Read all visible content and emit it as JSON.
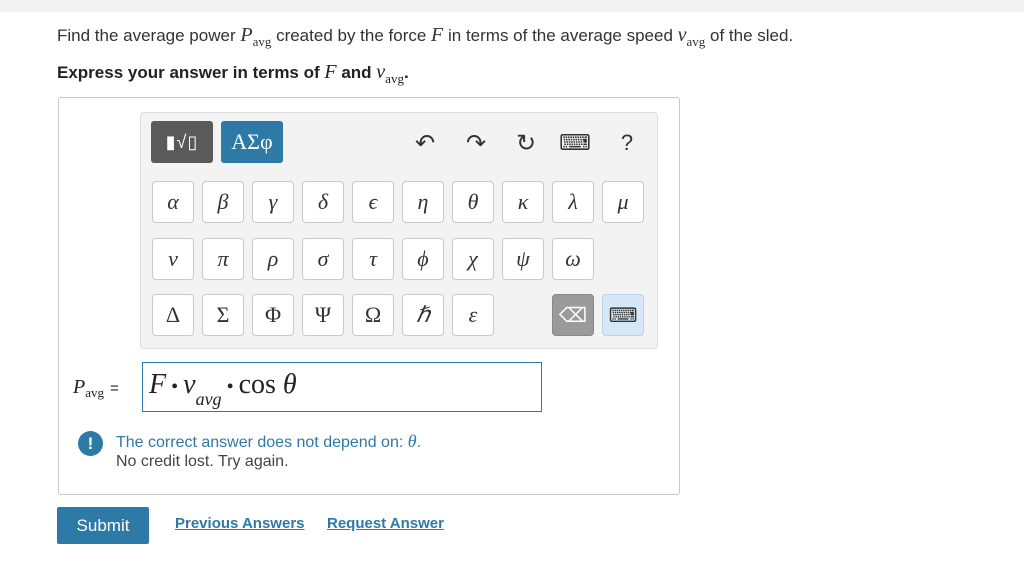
{
  "question": {
    "line1_a": "Find the average power ",
    "p_sym": "P",
    "p_sub": "avg",
    "line1_b": " created by the force ",
    "f_sym": "F",
    "line1_c": " in terms of the average speed ",
    "v_sym": "v",
    "v_sub": "avg",
    "line1_d": " of the sled.",
    "line2_a": "Express your answer in terms of ",
    "line2_f": "F",
    "line2_and": " and ",
    "line2_v": "v",
    "line2_vsub": "avg",
    "line2_end": "."
  },
  "toolbar": {
    "template_label": "▮√▯",
    "greek_label": "ΑΣφ",
    "undo": "↶",
    "redo": "↷",
    "reset": "↻",
    "keyboard": "⌨",
    "help": "?"
  },
  "keys_row1": [
    "α",
    "β",
    "γ",
    "δ",
    "ϵ",
    "η",
    "θ",
    "κ",
    "λ",
    "μ"
  ],
  "keys_row2": [
    "ν",
    "π",
    "ρ",
    "σ",
    "τ",
    "ϕ",
    "χ",
    "ψ",
    "ω"
  ],
  "keys_row3": [
    "Δ",
    "Σ",
    "Φ",
    "Ψ",
    "Ω",
    "ℏ",
    "ε"
  ],
  "keys_special": {
    "backspace": "⌫",
    "keyboard_toggle": "⌨"
  },
  "answer": {
    "label_sym": "P",
    "label_sub": "avg",
    "label_eq": "=",
    "expr_F": "F",
    "expr_dot1": " • ",
    "expr_v": "v",
    "expr_vsub": "avg",
    "expr_dot2": "  •  ",
    "expr_cos": "cos ",
    "expr_theta": "θ"
  },
  "feedback": {
    "icon": "!",
    "line1_a": "The correct answer does not depend on: ",
    "line1_theta": "θ",
    "line1_end": ".",
    "line2": "No credit lost. Try again."
  },
  "actions": {
    "submit": "Submit",
    "previous": "Previous Answers",
    "request": "Request Answer"
  }
}
